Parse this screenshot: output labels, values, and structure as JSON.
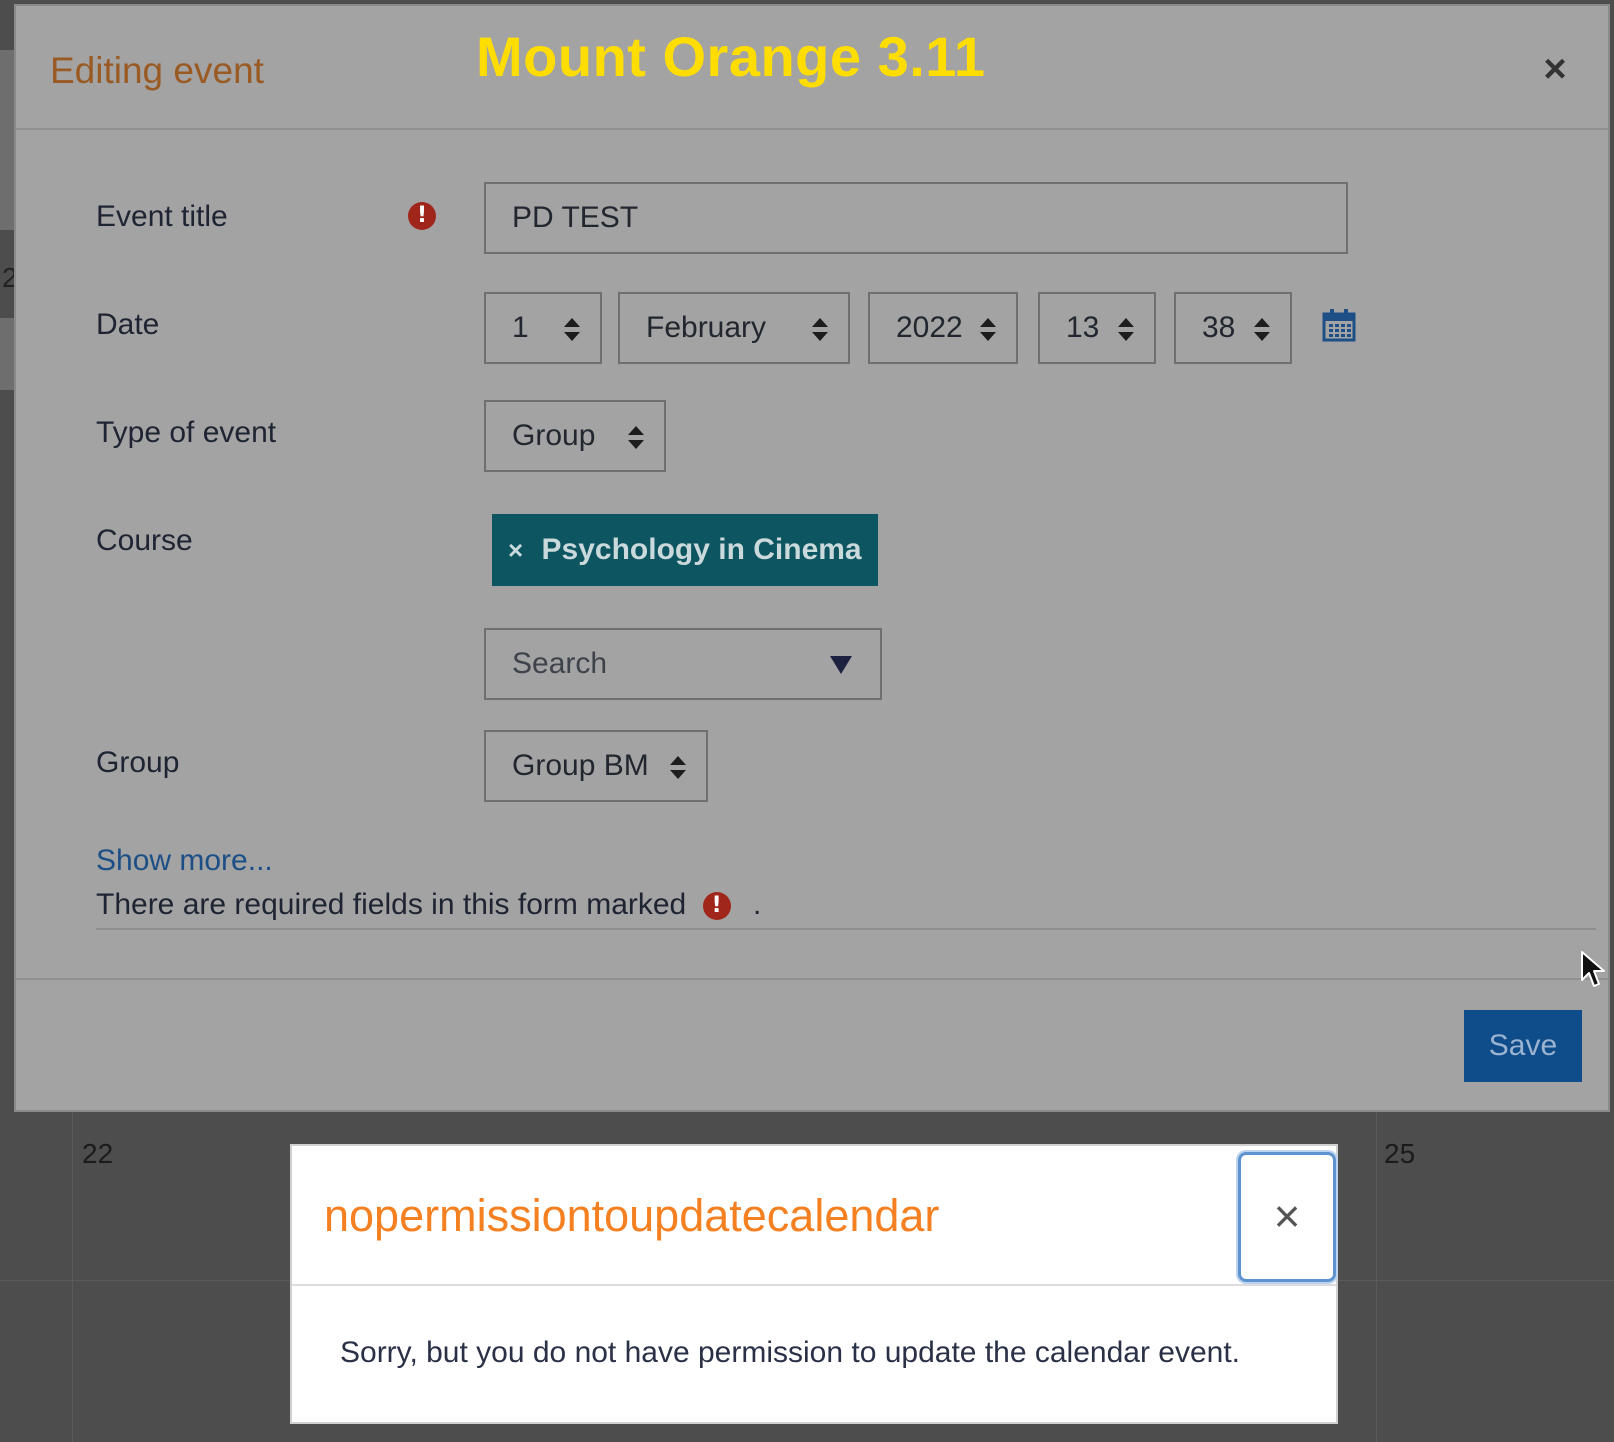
{
  "site_label": "Mount Orange 3.11",
  "modal": {
    "title": "Editing event",
    "close_symbol": "×",
    "fields": {
      "event_title": {
        "label": "Event title",
        "value": "PD TEST"
      },
      "date": {
        "label": "Date",
        "day": "1",
        "month": "February",
        "year": "2022",
        "hour": "13",
        "minute": "38"
      },
      "type": {
        "label": "Type of event",
        "value": "Group"
      },
      "course": {
        "label": "Course",
        "chip_remove": "×",
        "chip_label": "Psychology in Cinema",
        "search_placeholder": "Search"
      },
      "group": {
        "label": "Group",
        "value": "Group BM"
      }
    },
    "required_icon": "!",
    "show_more": "Show more...",
    "required_note": "There are required fields in this form marked",
    "required_note_end": ".",
    "save_label": "Save"
  },
  "background_calendar": {
    "day_a": "22",
    "day_b": "25",
    "partial_digit": "2"
  },
  "error_dialog": {
    "title": "nopermissiontoupdatecalendar",
    "close_symbol": "×",
    "message": "Sorry, but you do not have permission to update the calendar event."
  },
  "colors": {
    "modal_title": "#9a5a24",
    "site_label": "#ffdd00",
    "course_chip": "#0d5561",
    "save_button": "#0f4c8a",
    "error_title": "#f58021",
    "required_icon": "#a0251a"
  },
  "icons": {
    "required": "exclamation-circle-icon",
    "calendar": "calendar-icon",
    "close": "close-icon",
    "cursor": "mouse-pointer-icon",
    "dropdown": "caret-down-icon"
  }
}
